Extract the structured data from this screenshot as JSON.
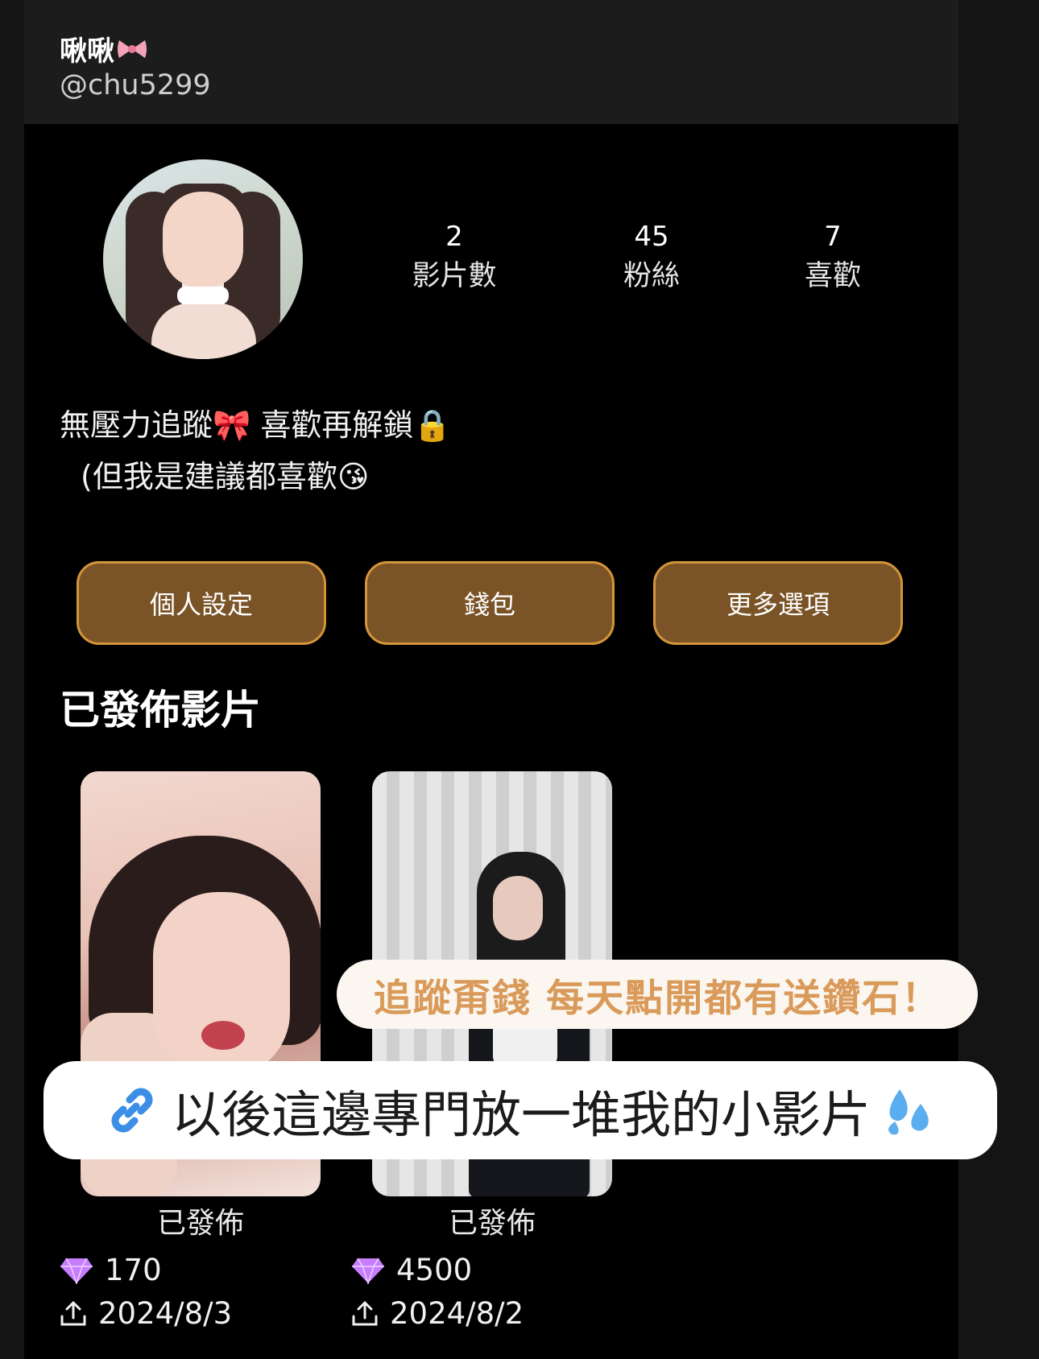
{
  "profile": {
    "display_name": "啾啾",
    "handle": "@chu5299",
    "bio_line1": "無壓力追蹤🎀 喜歡再解鎖🔒",
    "bio_line2": "(但我是建議都喜歡😘"
  },
  "stats": [
    {
      "value": "2",
      "label": "影片數"
    },
    {
      "value": "45",
      "label": "粉絲"
    },
    {
      "value": "7",
      "label": "喜歡"
    }
  ],
  "buttons": {
    "settings": "個人設定",
    "wallet": "錢包",
    "more": "更多選項"
  },
  "section_title": "已發佈影片",
  "videos": [
    {
      "status": "已發佈",
      "diamonds": "170",
      "date": "2024/8/3"
    },
    {
      "status": "已發佈",
      "diamonds": "4500",
      "date": "2024/8/2"
    }
  ],
  "overlay": {
    "banner_top": "追蹤甭錢 每天點開都有送鑽石！",
    "banner_main": "以後這邊專門放一堆我的小影片"
  },
  "icons": [
    "bow-icon",
    "lock-icon",
    "kiss-emoji-icon",
    "diamond-icon",
    "upload-icon",
    "link-icon",
    "sweat-drops-icon"
  ],
  "colors": {
    "button_fill": "#7a5326",
    "button_border": "#d3953a",
    "banner_accent": "#d99a5a",
    "diamond": "#c77dff"
  }
}
